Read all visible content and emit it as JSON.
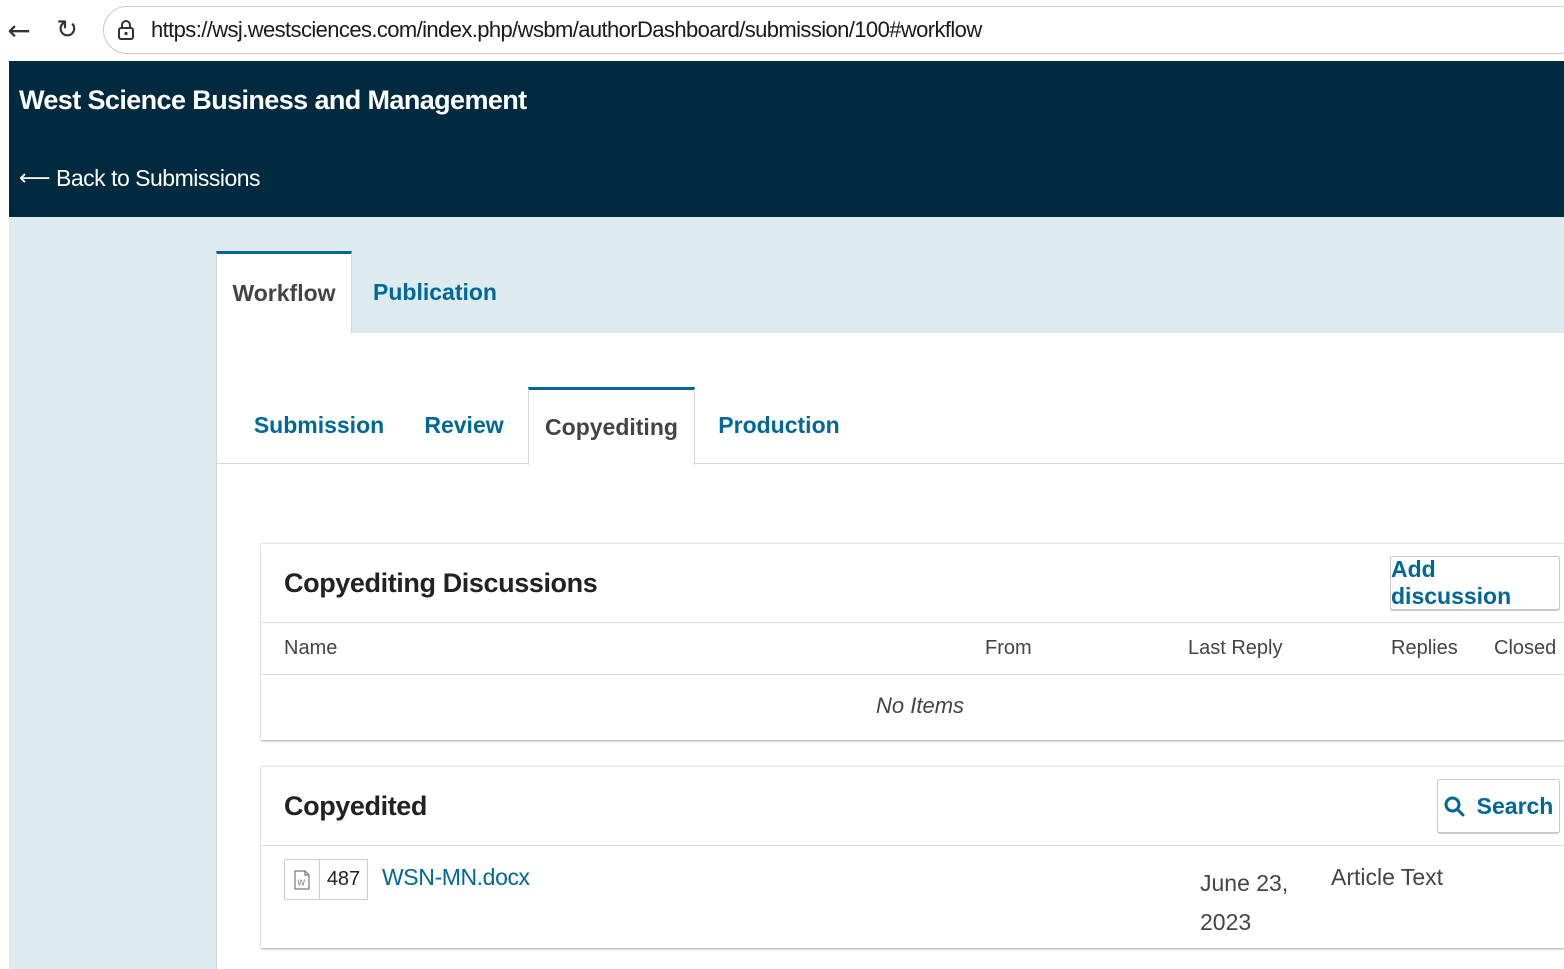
{
  "browser": {
    "url": "https://wsj.westsciences.com/index.php/wsbm/authorDashboard/submission/100#workflow"
  },
  "header": {
    "journal_title": "West Science Business and Management",
    "back_label": "Back to Submissions"
  },
  "main_tabs": [
    {
      "label": "Workflow",
      "active": true
    },
    {
      "label": "Publication",
      "active": false
    }
  ],
  "stage_tabs": [
    {
      "label": "Submission",
      "active": false
    },
    {
      "label": "Review",
      "active": false
    },
    {
      "label": "Copyediting",
      "active": true
    },
    {
      "label": "Production",
      "active": false
    }
  ],
  "discussions": {
    "title": "Copyediting Discussions",
    "add_button": "Add discussion",
    "columns": [
      "Name",
      "From",
      "Last Reply",
      "Replies",
      "Closed"
    ],
    "empty_text": "No Items"
  },
  "copyedited": {
    "title": "Copyedited",
    "search_button": "Search",
    "files": [
      {
        "id": "487",
        "name": "WSN-MN.docx",
        "date": "June 23, 2023",
        "type": "Article Text"
      }
    ]
  },
  "colors": {
    "header_bg": "#002a3f",
    "link": "#006798",
    "page_bg": "#ddeaee"
  }
}
